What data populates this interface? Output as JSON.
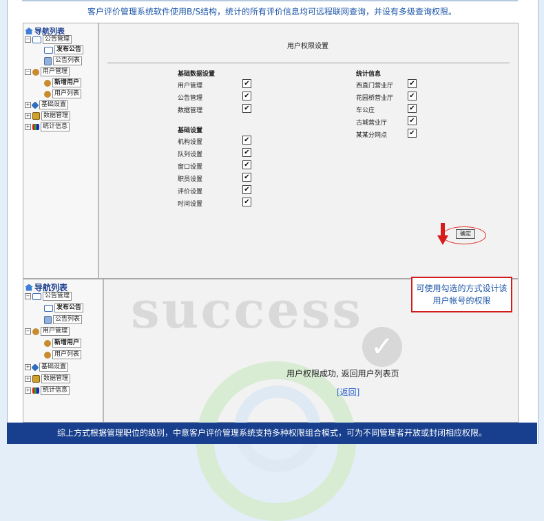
{
  "top_caption": "客户评价管理系统软件使用B/S结构，统计的所有评价信息均可远程联网查询，并设有多级查询权限。",
  "nav": {
    "title": "导航列表",
    "groups": [
      {
        "label": "公告管理",
        "children": [
          "发布公告",
          "公告列表"
        ]
      },
      {
        "label": "用户管理",
        "children": [
          "新增用户",
          "用户列表"
        ]
      },
      {
        "label": "基础设置",
        "children": []
      },
      {
        "label": "数据管理",
        "children": []
      },
      {
        "label": "统计信息",
        "children": []
      }
    ]
  },
  "form": {
    "title": "用户权限设置",
    "basic_data_section": {
      "heading": "基础数据设置",
      "items": [
        {
          "label": "用户管理",
          "checked": true
        },
        {
          "label": "公告管理",
          "checked": true
        },
        {
          "label": "数据管理",
          "checked": true
        }
      ]
    },
    "basic_settings_section": {
      "heading": "基础设置",
      "items": [
        {
          "label": "机构设置",
          "checked": true
        },
        {
          "label": "队列设置",
          "checked": true
        },
        {
          "label": "窗口设置",
          "checked": true
        },
        {
          "label": "职员设置",
          "checked": true
        },
        {
          "label": "评价设置",
          "checked": true
        },
        {
          "label": "时间设置",
          "checked": true
        }
      ]
    },
    "stats_section": {
      "heading": "统计信息",
      "items": [
        {
          "label": "西直门营业厅",
          "checked": true
        },
        {
          "label": "花园桥营业厅",
          "checked": true
        },
        {
          "label": "车公庄",
          "checked": true
        },
        {
          "label": "古城营业厅",
          "checked": true
        },
        {
          "label": "某某分网点",
          "checked": true
        }
      ]
    },
    "confirm_label": "确定",
    "check_glyph": "✔"
  },
  "callout_text": "可使用勾选的方式设计该用户帐号的权限",
  "result": {
    "watermark": "success",
    "tick_glyph": "✓",
    "message": "用户权限成功, 返回用户列表页",
    "back_link": "[返回]"
  },
  "bottom_caption": "综上方式根据管理职位的级别，中意客户评价管理系统支持多种权限组合模式，可为不同管理者开放或封闭相应权限。",
  "colors": {
    "accent_blue": "#1b55a8",
    "footer_bar": "#173f8e",
    "highlight_red": "#d71c1c"
  }
}
